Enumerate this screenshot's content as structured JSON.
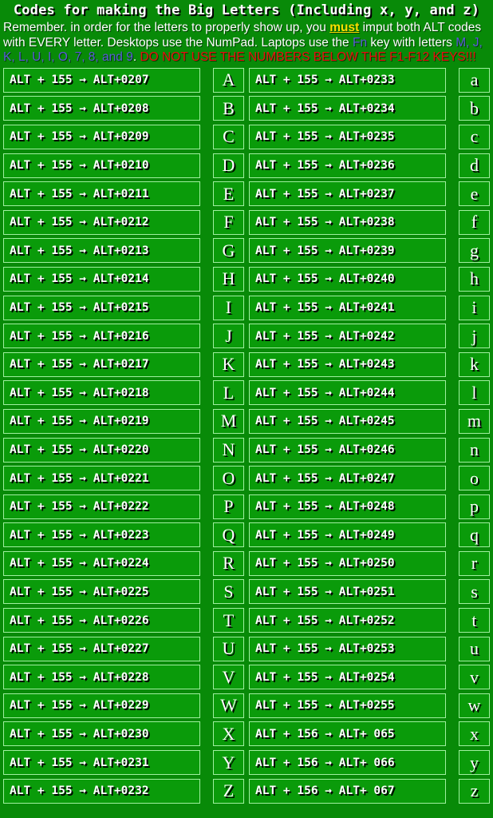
{
  "header": {
    "title": "Codes for making the Big Letters (Including x, y, and z)",
    "intro": {
      "part1": "Remember. in order for the letters to properly show up, you ",
      "must": "must",
      "part2": " imput both ALT codes with EVERY letter. Desktops use the NumPad. Laptops use the ",
      "fn": "Fn",
      "part3": " key with letters ",
      "keys": "M, J, K, L, U, I, O, 7, 8, and 9",
      "part4": ". ",
      "warning": "DO NOT USE THE NUMBERS BELOW THE F1-F12 KEYS!!!"
    }
  },
  "colors": {
    "page_background": "#088a08",
    "cell_background": "#0a9b0a",
    "cell_border": "#9ff09f",
    "text": "#ffffff",
    "must_highlight": "#ffe000",
    "key_highlight": "#5a5ad8",
    "warning": "#e81010"
  },
  "table": {
    "rows": [
      {
        "upper_code": "ALT + 155 → ALT+0207",
        "upper_letter": "A",
        "lower_code": "ALT + 155 → ALT+0233",
        "lower_letter": "a"
      },
      {
        "upper_code": "ALT + 155 → ALT+0208",
        "upper_letter": "B",
        "lower_code": "ALT + 155 → ALT+0234",
        "lower_letter": "b"
      },
      {
        "upper_code": "ALT + 155 → ALT+0209",
        "upper_letter": "C",
        "lower_code": "ALT + 155 → ALT+0235",
        "lower_letter": "c"
      },
      {
        "upper_code": "ALT + 155 → ALT+0210",
        "upper_letter": "D",
        "lower_code": "ALT + 155 → ALT+0236",
        "lower_letter": "d"
      },
      {
        "upper_code": "ALT + 155 → ALT+0211",
        "upper_letter": "E",
        "lower_code": "ALT + 155 → ALT+0237",
        "lower_letter": "e"
      },
      {
        "upper_code": "ALT + 155 → ALT+0212",
        "upper_letter": "F",
        "lower_code": "ALT + 155 → ALT+0238",
        "lower_letter": "f"
      },
      {
        "upper_code": "ALT + 155 → ALT+0213",
        "upper_letter": "G",
        "lower_code": "ALT + 155 → ALT+0239",
        "lower_letter": "g"
      },
      {
        "upper_code": "ALT + 155 → ALT+0214",
        "upper_letter": "H",
        "lower_code": "ALT + 155 → ALT+0240",
        "lower_letter": "h"
      },
      {
        "upper_code": "ALT + 155 → ALT+0215",
        "upper_letter": "I",
        "lower_code": "ALT + 155 → ALT+0241",
        "lower_letter": "i"
      },
      {
        "upper_code": "ALT + 155 → ALT+0216",
        "upper_letter": "J",
        "lower_code": "ALT + 155 → ALT+0242",
        "lower_letter": "j"
      },
      {
        "upper_code": "ALT + 155 → ALT+0217",
        "upper_letter": "K",
        "lower_code": "ALT + 155 → ALT+0243",
        "lower_letter": "k"
      },
      {
        "upper_code": "ALT + 155 → ALT+0218",
        "upper_letter": "L",
        "lower_code": "ALT + 155 → ALT+0244",
        "lower_letter": "l"
      },
      {
        "upper_code": "ALT + 155 → ALT+0219",
        "upper_letter": "M",
        "lower_code": "ALT + 155 → ALT+0245",
        "lower_letter": "m"
      },
      {
        "upper_code": "ALT + 155 → ALT+0220",
        "upper_letter": "N",
        "lower_code": "ALT + 155 → ALT+0246",
        "lower_letter": "n"
      },
      {
        "upper_code": "ALT + 155 → ALT+0221",
        "upper_letter": "O",
        "lower_code": "ALT + 155 → ALT+0247",
        "lower_letter": "o"
      },
      {
        "upper_code": "ALT + 155 → ALT+0222",
        "upper_letter": "P",
        "lower_code": "ALT + 155 → ALT+0248",
        "lower_letter": "p"
      },
      {
        "upper_code": "ALT + 155 → ALT+0223",
        "upper_letter": "Q",
        "lower_code": "ALT + 155 → ALT+0249",
        "lower_letter": "q"
      },
      {
        "upper_code": "ALT + 155 → ALT+0224",
        "upper_letter": "R",
        "lower_code": "ALT + 155 → ALT+0250",
        "lower_letter": "r"
      },
      {
        "upper_code": "ALT + 155 → ALT+0225",
        "upper_letter": "S",
        "lower_code": "ALT + 155 → ALT+0251",
        "lower_letter": "s"
      },
      {
        "upper_code": "ALT + 155 → ALT+0226",
        "upper_letter": "T",
        "lower_code": "ALT + 155 → ALT+0252",
        "lower_letter": "t"
      },
      {
        "upper_code": "ALT + 155 → ALT+0227",
        "upper_letter": "U",
        "lower_code": "ALT + 155 → ALT+0253",
        "lower_letter": "u"
      },
      {
        "upper_code": "ALT + 155 → ALT+0228",
        "upper_letter": "V",
        "lower_code": "ALT + 155 → ALT+0254",
        "lower_letter": "v"
      },
      {
        "upper_code": "ALT + 155 → ALT+0229",
        "upper_letter": "W",
        "lower_code": "ALT + 155 → ALT+0255",
        "lower_letter": "w"
      },
      {
        "upper_code": "ALT + 155 → ALT+0230",
        "upper_letter": "X",
        "lower_code": "ALT + 156 → ALT+ 065",
        "lower_letter": "x"
      },
      {
        "upper_code": "ALT + 155 → ALT+0231",
        "upper_letter": "Y",
        "lower_code": "ALT + 156 → ALT+ 066",
        "lower_letter": "y"
      },
      {
        "upper_code": "ALT + 155 → ALT+0232",
        "upper_letter": "Z",
        "lower_code": "ALT + 156 → ALT+ 067",
        "lower_letter": "z"
      }
    ]
  }
}
